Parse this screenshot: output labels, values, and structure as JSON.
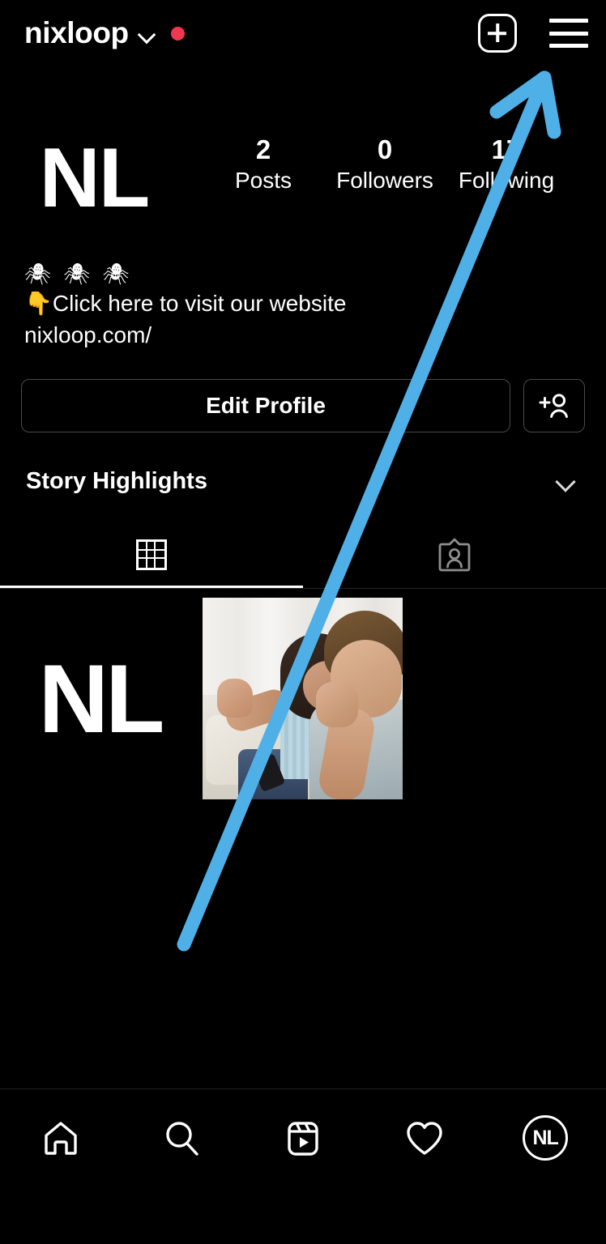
{
  "app": "Instagram",
  "topbar": {
    "username": "nixloop",
    "chevron_icon": "chevron-down-icon",
    "status_dot_color": "#F0374F",
    "new_post_icon": "plus-square-icon",
    "menu_icon": "hamburger-menu-icon"
  },
  "profile": {
    "avatar_text": "NL",
    "stats": [
      {
        "value": "2",
        "label": "Posts"
      },
      {
        "value": "0",
        "label": "Followers"
      },
      {
        "value": "17",
        "label": "Following"
      }
    ],
    "bio": {
      "emojis": "🕷 🕷 🕷",
      "line": "👇Click here to visit our website",
      "link": "nixloop.com/"
    },
    "edit_profile_label": "Edit Profile",
    "add_person_icon": "add-person-icon"
  },
  "highlights": {
    "title": "Story Highlights",
    "chevron_icon": "chevron-down-icon"
  },
  "tabs": [
    {
      "name": "grid",
      "icon": "grid-icon",
      "active": true
    },
    {
      "name": "tagged",
      "icon": "tagged-person-icon",
      "active": false
    }
  ],
  "posts": [
    {
      "type": "logo",
      "text": "NL"
    },
    {
      "type": "photo",
      "alt": "couple sitting on couch arguing"
    }
  ],
  "bottom_nav": [
    {
      "name": "home",
      "icon": "home-icon"
    },
    {
      "name": "search",
      "icon": "search-icon"
    },
    {
      "name": "reels",
      "icon": "reels-icon"
    },
    {
      "name": "activity",
      "icon": "heart-icon"
    },
    {
      "name": "profile",
      "icon": "profile-avatar",
      "avatar_text": "NL"
    }
  ],
  "annotation": {
    "type": "arrow",
    "color": "#4FB0E8",
    "points_to": "hamburger-menu-icon"
  }
}
